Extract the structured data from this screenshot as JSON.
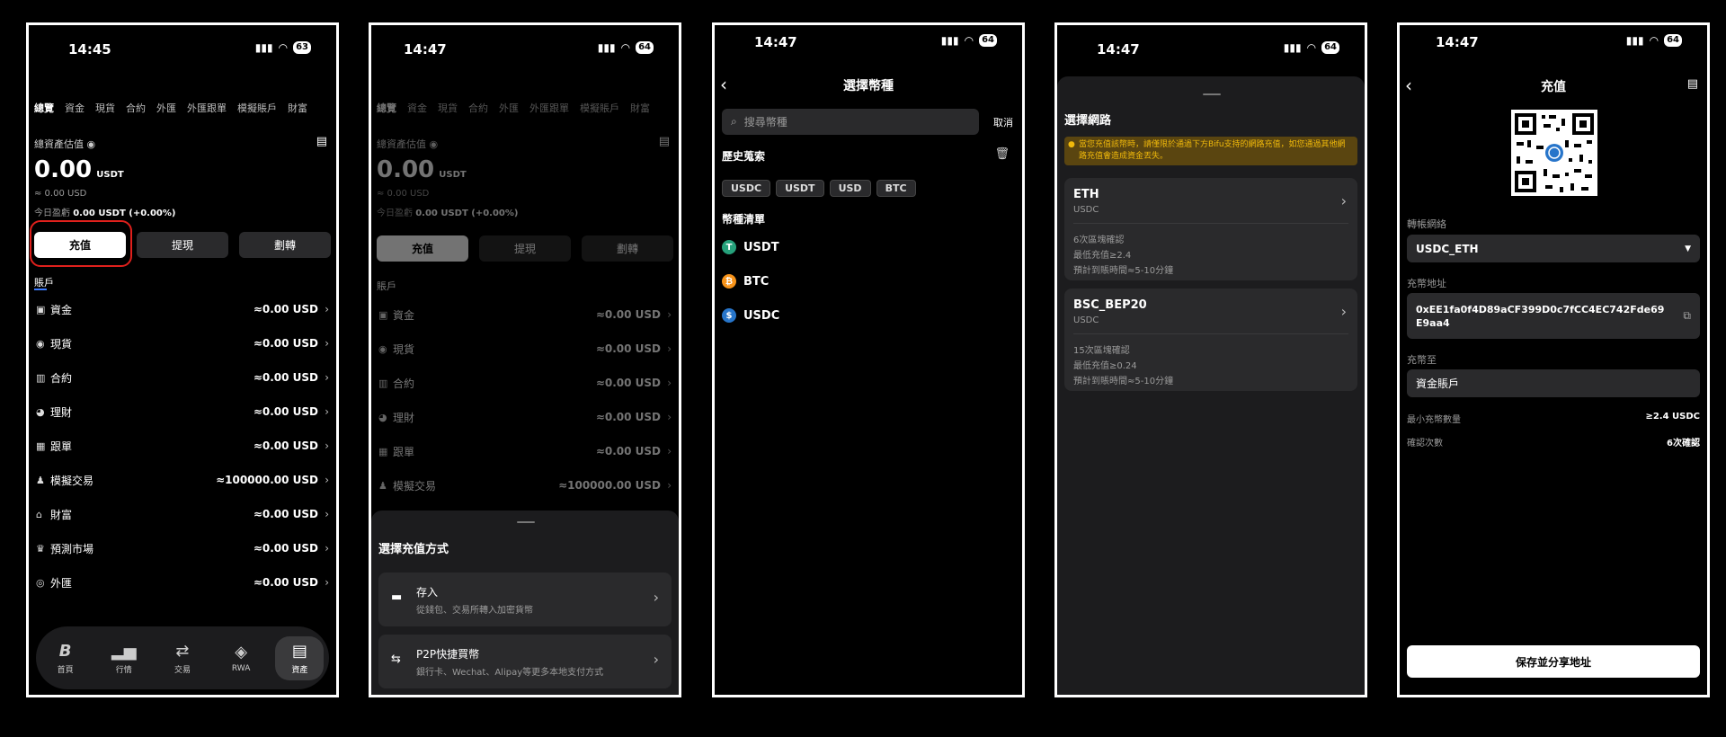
{
  "status": {
    "p1_time": "14:45",
    "p1_battery": "63",
    "time": "14:47",
    "battery": "64"
  },
  "screen1": {
    "tabs": [
      "總覽",
      "資金",
      "現貨",
      "合約",
      "外匯",
      "外匯跟單",
      "模擬賬戶",
      "財富"
    ],
    "asset_label": "總資產估值",
    "balance": "0.00",
    "balance_unit": "USDT",
    "approx_usd": "≈ 0.00 USD",
    "pnl_label": "今日盈虧",
    "pnl_value": "0.00 USDT (+0.00%)",
    "deposit": "充值",
    "withdraw": "提現",
    "transfer": "劃轉",
    "accounts_title": "賬戶",
    "accounts": [
      {
        "label": "資金",
        "value": "≈0.00 USD"
      },
      {
        "label": "現貨",
        "value": "≈0.00 USD"
      },
      {
        "label": "合約",
        "value": "≈0.00 USD"
      },
      {
        "label": "理財",
        "value": "≈0.00 USD"
      },
      {
        "label": "跟單",
        "value": "≈0.00 USD"
      },
      {
        "label": "模擬交易",
        "value": "≈100000.00 USD"
      },
      {
        "label": "財富",
        "value": "≈0.00 USD"
      },
      {
        "label": "預測市場",
        "value": "≈0.00 USD"
      },
      {
        "label": "外匯",
        "value": "≈0.00 USD"
      }
    ],
    "nav": [
      "首頁",
      "行情",
      "交易",
      "RWA",
      "資產"
    ],
    "highlight_color": "#e0201c"
  },
  "screen2": {
    "sheet_title": "選擇充值方式",
    "options": [
      {
        "title": "存入",
        "desc": "從錢包、交易所轉入加密貨幣"
      },
      {
        "title": "P2P快捷買幣",
        "desc": "銀行卡、Wechat、Alipay等更多本地支付方式"
      }
    ]
  },
  "screen3": {
    "title": "選擇幣種",
    "search_placeholder": "搜尋幣種",
    "cancel": "取消",
    "history_title": "歷史蒐索",
    "history": [
      "USDC",
      "USDT",
      "USD",
      "BTC"
    ],
    "list_title": "幣種清單",
    "coins": [
      {
        "name": "USDT",
        "color": "#26a17b",
        "glyph": "T"
      },
      {
        "name": "BTC",
        "color": "#f7931a",
        "glyph": "₿"
      },
      {
        "name": "USDC",
        "color": "#2775ca",
        "glyph": "$"
      }
    ]
  },
  "screen4": {
    "title": "選擇網路",
    "warning": "當您充值該幣時，請僅限於通過下方Bifu支持的網路充值，如您通過其他網路充值會造成資金丟失。",
    "warning_color": "#f0b90b",
    "networks": [
      {
        "name": "ETH",
        "coin": "USDC",
        "l1": "6次區塊確認",
        "l2": "最低充值≥2.4",
        "l3": "預計到賬時間≈5-10分鐘"
      },
      {
        "name": "BSC_BEP20",
        "coin": "USDC",
        "l1": "15次區塊確認",
        "l2": "最低充值≥0.24",
        "l3": "預計到賬時間≈5-10分鐘"
      }
    ]
  },
  "screen5": {
    "title": "充值",
    "network_label": "轉帳網絡",
    "network_value": "USDC_ETH",
    "address_label": "充幣地址",
    "address_value": "0xEE1fa0f4D89aCF399D0c7fCC4EC742Fde69E9aa4",
    "to_label": "充幣至",
    "to_value": "資金賬戶",
    "min_label": "最小充幣數量",
    "min_value": "≥2.4 USDC",
    "confirm_label": "確認次數",
    "confirm_value": "6次確認",
    "save_button": "保存並分享地址"
  }
}
